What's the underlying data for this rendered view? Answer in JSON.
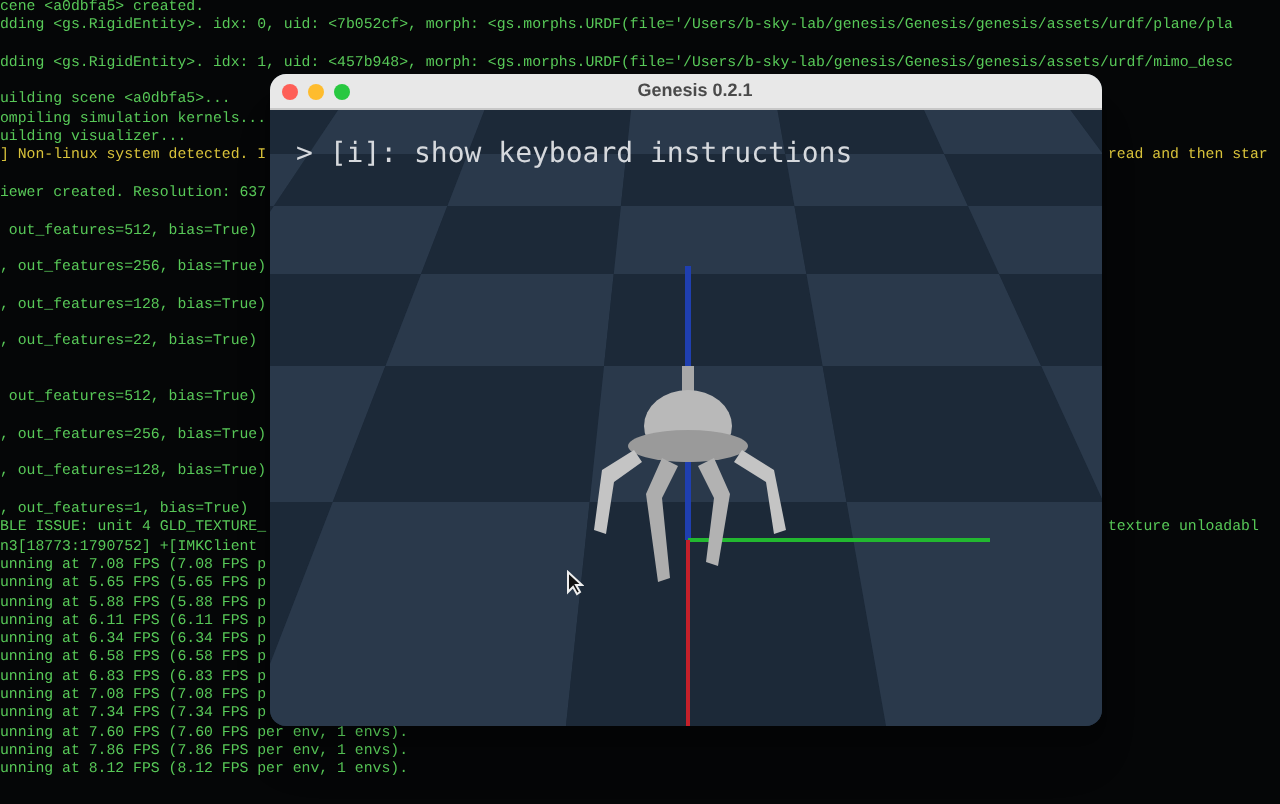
{
  "terminal": {
    "lines": [
      {
        "kind": "log",
        "text": "cene <a0dbfa5> created."
      },
      {
        "kind": "log",
        "text": "dding <gs.RigidEntity>. idx: 0, uid: <7b052cf>, morph: <gs.morphs.URDF(file='/Users/b-sky-lab/genesis/Genesis/genesis/assets/urdf/plane/pla"
      },
      {
        "kind": "blank"
      },
      {
        "kind": "log",
        "text": "dding <gs.RigidEntity>. idx: 1, uid: <457b948>, morph: <gs.morphs.URDF(file='/Users/b-sky-lab/genesis/Genesis/genesis/assets/urdf/mimo_desc"
      },
      {
        "kind": "blank"
      },
      {
        "kind": "log",
        "text": "uilding scene <a0dbfa5>..."
      },
      {
        "kind": "log",
        "text": "ompiling simulation kernels..."
      },
      {
        "kind": "log",
        "text": "uilding visualizer..."
      },
      {
        "kind": "warning",
        "text": "] Non-linux system detected. I",
        "right": "read and then star"
      },
      {
        "kind": "blank"
      },
      {
        "kind": "log",
        "text": "iewer created. Resolution: 637"
      },
      {
        "kind": "blank"
      },
      {
        "kind": "log",
        "text": " out_features=512, bias=True)"
      },
      {
        "kind": "blank"
      },
      {
        "kind": "log",
        "text": ", out_features=256, bias=True)"
      },
      {
        "kind": "blank"
      },
      {
        "kind": "log",
        "text": ", out_features=128, bias=True)"
      },
      {
        "kind": "blank"
      },
      {
        "kind": "log",
        "text": ", out_features=22, bias=True)"
      },
      {
        "kind": "blank"
      },
      {
        "kind": "blank"
      },
      {
        "kind": "log",
        "text": " out_features=512, bias=True)"
      },
      {
        "kind": "blank"
      },
      {
        "kind": "log",
        "text": ", out_features=256, bias=True)"
      },
      {
        "kind": "blank"
      },
      {
        "kind": "log",
        "text": ", out_features=128, bias=True)"
      },
      {
        "kind": "blank"
      },
      {
        "kind": "log",
        "text": ", out_features=1, bias=True)"
      },
      {
        "kind": "log",
        "text": "BLE ISSUE: unit 4 GLD_TEXTURE_",
        "right": "texture unloadabl"
      },
      {
        "kind": "log",
        "text": "n3[18773:1790752] +[IMKClient"
      },
      {
        "kind": "log",
        "text": "unning at 7.08 FPS (7.08 FPS p"
      },
      {
        "kind": "log",
        "text": "unning at 5.65 FPS (5.65 FPS p"
      },
      {
        "kind": "log",
        "text": "unning at 5.88 FPS (5.88 FPS p"
      },
      {
        "kind": "log",
        "text": "unning at 6.11 FPS (6.11 FPS p"
      },
      {
        "kind": "log",
        "text": "unning at 6.34 FPS (6.34 FPS p"
      },
      {
        "kind": "log",
        "text": "unning at 6.58 FPS (6.58 FPS p"
      },
      {
        "kind": "log",
        "text": "unning at 6.83 FPS (6.83 FPS p"
      },
      {
        "kind": "log",
        "text": "unning at 7.08 FPS (7.08 FPS p"
      },
      {
        "kind": "log",
        "text": "unning at 7.34 FPS (7.34 FPS p"
      },
      {
        "kind": "log",
        "text": "unning at 7.60 FPS (7.60 FPS per env, 1 envs)."
      },
      {
        "kind": "log",
        "text": "unning at 7.86 FPS (7.86 FPS per env, 1 envs)."
      },
      {
        "kind": "log",
        "text": "unning at 8.12 FPS (8.12 FPS per env, 1 envs)."
      }
    ]
  },
  "window": {
    "title": "Genesis 0.2.1",
    "overlay_text": "> [i]: show keyboard instructions"
  }
}
